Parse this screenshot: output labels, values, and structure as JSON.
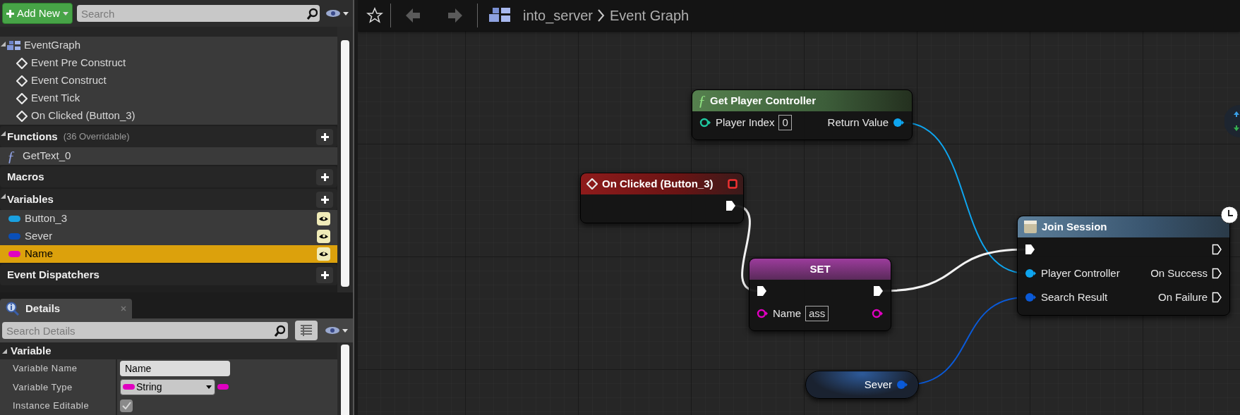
{
  "my_blueprint": {
    "add_button": "Add New",
    "search": {
      "placeholder": "Search"
    },
    "graphs": [
      {
        "label": "EventGraph",
        "children": [
          {
            "label": "Event Pre Construct"
          },
          {
            "label": "Event Construct"
          },
          {
            "label": "Event Tick"
          },
          {
            "label": "On Clicked (Button_3)"
          }
        ]
      }
    ],
    "sections": [
      {
        "kind": "functions",
        "title": "Functions",
        "note": "(36 Overridable)",
        "items": [
          {
            "label": "GetText_0",
            "icon": "ƒ"
          }
        ]
      },
      {
        "kind": "macros",
        "title": "Macros"
      },
      {
        "kind": "variables",
        "title": "Variables",
        "items": [
          {
            "label": "Button_3",
            "color": "#1aa0e0",
            "selected": false
          },
          {
            "label": "Sever",
            "color": "#0a4fb8",
            "selected": false
          },
          {
            "label": "Name",
            "color": "#e000c0",
            "selected": true
          }
        ]
      },
      {
        "kind": "dispatchers",
        "title": "Event Dispatchers"
      }
    ]
  },
  "details": {
    "tab": "Details",
    "search": {
      "placeholder": "Search Details"
    },
    "section": "Variable",
    "properties": [
      {
        "kind": "text",
        "label": "Variable Name",
        "value": "Name"
      },
      {
        "kind": "type",
        "label": "Variable Type",
        "value": "String",
        "color": "#e000c0"
      },
      {
        "kind": "checkbox",
        "label": "Instance Editable",
        "checked": true
      }
    ]
  },
  "graph": {
    "breadcrumb": [
      "into_server",
      "Event Graph"
    ],
    "nodes": [
      {
        "kind": "function",
        "icon": "ƒ",
        "title": "Get Player Controller",
        "inputs": [
          {
            "kind": "data",
            "label": "Player Index",
            "value": "0",
            "color": "#1fc8a0",
            "connected": false
          }
        ],
        "outputs": [
          {
            "kind": "data",
            "label": "Return Value",
            "color": "#0ea5ef",
            "connected": true
          }
        ]
      },
      {
        "kind": "event",
        "title": "On Clicked (Button_3)",
        "outputs": [
          {
            "kind": "exec",
            "connected": true
          }
        ]
      },
      {
        "kind": "set",
        "title": "SET",
        "inputs": [
          {
            "kind": "exec",
            "connected": true
          },
          {
            "kind": "data",
            "label": "Name",
            "value": "ass",
            "color": "#e000c0",
            "connected": false
          }
        ],
        "outputs": [
          {
            "kind": "exec",
            "connected": true
          },
          {
            "kind": "data",
            "color": "#e000c0",
            "connected": false
          }
        ]
      },
      {
        "kind": "latent",
        "title": "Join Session",
        "inputs": [
          {
            "kind": "exec",
            "connected": true
          },
          {
            "kind": "data",
            "label": "Player Controller",
            "color": "#0ea5ef",
            "connected": true
          },
          {
            "kind": "data",
            "label": "Search Result",
            "color": "#0a5ad8",
            "connected": true
          }
        ],
        "outputs": [
          {
            "kind": "exec",
            "connected": false
          },
          {
            "kind": "exec",
            "label": "On Success",
            "connected": false
          },
          {
            "kind": "exec",
            "label": "On Failure",
            "connected": false
          }
        ]
      },
      {
        "kind": "getter",
        "title": "Sever",
        "outputs": [
          {
            "kind": "data",
            "color": "#0a5ad8",
            "connected": true
          }
        ]
      }
    ]
  }
}
